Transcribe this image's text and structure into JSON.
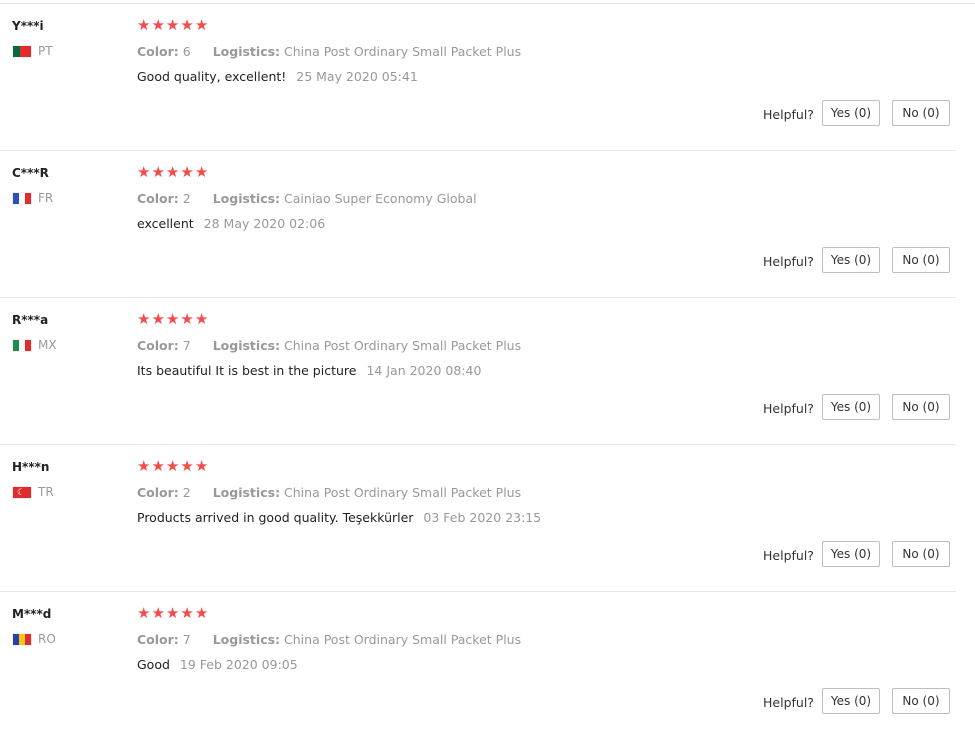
{
  "helpful_label": "Helpful?",
  "star_color": "#f44b4b",
  "reviews": [
    {
      "user": "Y***i",
      "country": "PT",
      "flag": [
        "#0a6b3a",
        "#0a6b3a",
        "#e22b2b",
        "#e22b2b",
        "#e22b2b"
      ],
      "stars": 5,
      "color_label": "Color:",
      "color_value": "6",
      "logistics_label": "Logistics:",
      "logistics_value": "China Post Ordinary Small Packet Plus",
      "text": "Good quality, excellent!",
      "date": "25 May 2020 05:41",
      "yes": "Yes (0)",
      "no": "No (0)"
    },
    {
      "user": "C***R",
      "country": "FR",
      "flag": [
        "#2d4fbf",
        "#ffffff",
        "#e22b2b"
      ],
      "stars": 5,
      "color_label": "Color:",
      "color_value": "2",
      "logistics_label": "Logistics:",
      "logistics_value": "Cainiao Super Economy Global",
      "text": "excellent",
      "date": "28 May 2020 02:06",
      "yes": "Yes (0)",
      "no": "No (0)"
    },
    {
      "user": "R***a",
      "country": "MX",
      "flag": [
        "#1f8a4c",
        "#ffffff",
        "#e22b2b"
      ],
      "stars": 5,
      "color_label": "Color:",
      "color_value": "7",
      "logistics_label": "Logistics:",
      "logistics_value": "China Post Ordinary Small Packet Plus",
      "text": "Its beautiful It is best in the picture",
      "date": "14 Jan 2020 08:40",
      "yes": "Yes (0)",
      "no": "No (0)"
    },
    {
      "user": "H***n",
      "country": "TR",
      "flag": [
        "#e22b2b"
      ],
      "stars": 5,
      "color_label": "Color:",
      "color_value": "2",
      "logistics_label": "Logistics:",
      "logistics_value": "China Post Ordinary Small Packet Plus",
      "text": "Products arrived in good quality. Teşekkürler",
      "date": "03 Feb 2020 23:15",
      "yes": "Yes (0)",
      "no": "No (0)"
    },
    {
      "user": "M***d",
      "country": "RO",
      "flag": [
        "#2d3fa8",
        "#f5c518",
        "#e22b2b"
      ],
      "stars": 5,
      "color_label": "Color:",
      "color_value": "7",
      "logistics_label": "Logistics:",
      "logistics_value": "China Post Ordinary Small Packet Plus",
      "text": "Good",
      "date": "19 Feb 2020 09:05",
      "yes": "Yes (0)",
      "no": "No (0)"
    }
  ]
}
